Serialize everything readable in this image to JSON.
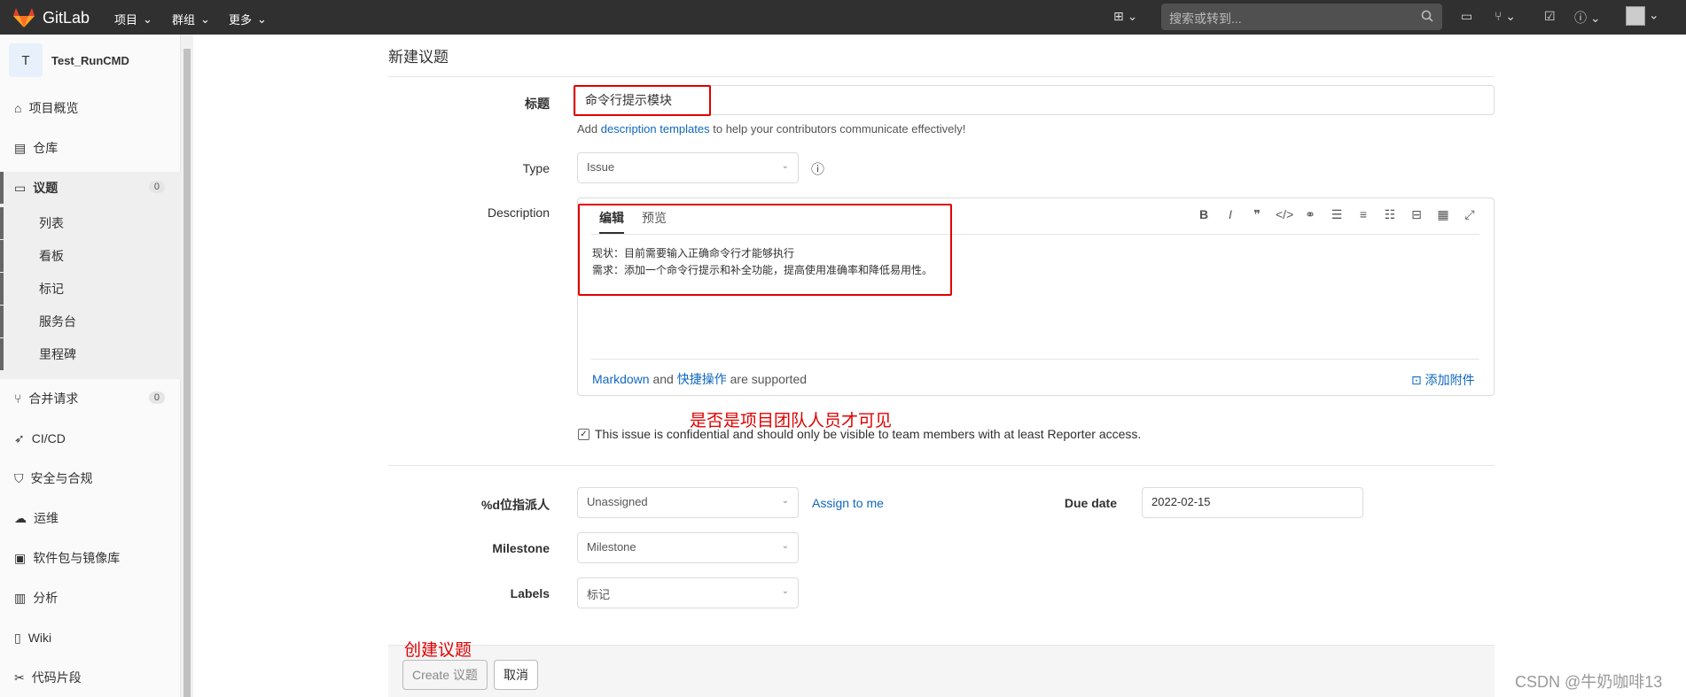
{
  "topbar": {
    "brand": "GitLab",
    "nav": [
      "项目",
      "群组",
      "更多"
    ],
    "search_placeholder": "搜索或转到..."
  },
  "sidebar": {
    "project_initial": "T",
    "project_name": "Test_RunCMD",
    "items": [
      {
        "label": "项目概览",
        "icon": "home-icon"
      },
      {
        "label": "仓库",
        "icon": "file-icon"
      },
      {
        "label": "议题",
        "icon": "issues-icon",
        "badge": "0"
      },
      {
        "label": "合并请求",
        "icon": "merge-request-icon",
        "badge": "0"
      },
      {
        "label": "CI/CD",
        "icon": "rocket-icon"
      },
      {
        "label": "安全与合规",
        "icon": "shield-icon"
      },
      {
        "label": "运维",
        "icon": "cloud-icon"
      },
      {
        "label": "软件包与镜像库",
        "icon": "package-icon"
      },
      {
        "label": "分析",
        "icon": "chart-icon"
      },
      {
        "label": "Wiki",
        "icon": "book-icon"
      },
      {
        "label": "代码片段",
        "icon": "scissors-icon"
      }
    ],
    "subitems": [
      "列表",
      "看板",
      "标记",
      "服务台",
      "里程碑"
    ]
  },
  "form": {
    "page_title": "新建议题",
    "title_label": "标题",
    "title_value": "命令行提示模块",
    "hint_add": "Add",
    "hint_link": "description templates",
    "hint_rest": "to help your contributors communicate effectively!",
    "type_label": "Type",
    "type_value": "Issue",
    "description_label": "Description",
    "tab_edit": "编辑",
    "tab_preview": "预览",
    "description_line1": "现状：目前需要输入正确命令行才能够执行",
    "description_line2": "需求：添加一个命令行提示和补全功能，提高使用准确率和降低易用性。",
    "md_link": "Markdown",
    "md_and": "and",
    "md_shortcuts": "快捷操作",
    "md_supported": "are supported",
    "attach": "添加附件",
    "confidential_text": "This issue is confidential and should only be visible to team members with at least Reporter access.",
    "assignee_label": "%d位指派人",
    "assignee_value": "Unassigned",
    "assign_me": "Assign to me",
    "due_label": "Due date",
    "due_value": "2022-02-15",
    "milestone_label": "Milestone",
    "milestone_value": "Milestone",
    "labels_label": "Labels",
    "labels_value": "标记",
    "create_button": "Create 议题",
    "cancel_button": "取消"
  },
  "annotations": {
    "confidential_note": "是否是项目团队人员才可见",
    "create_note": "创建议题"
  },
  "watermark": "CSDN @牛奶咖啡13",
  "colors": {
    "topbar": "#303030",
    "link": "#1068bf",
    "annotation": "#e00000"
  }
}
